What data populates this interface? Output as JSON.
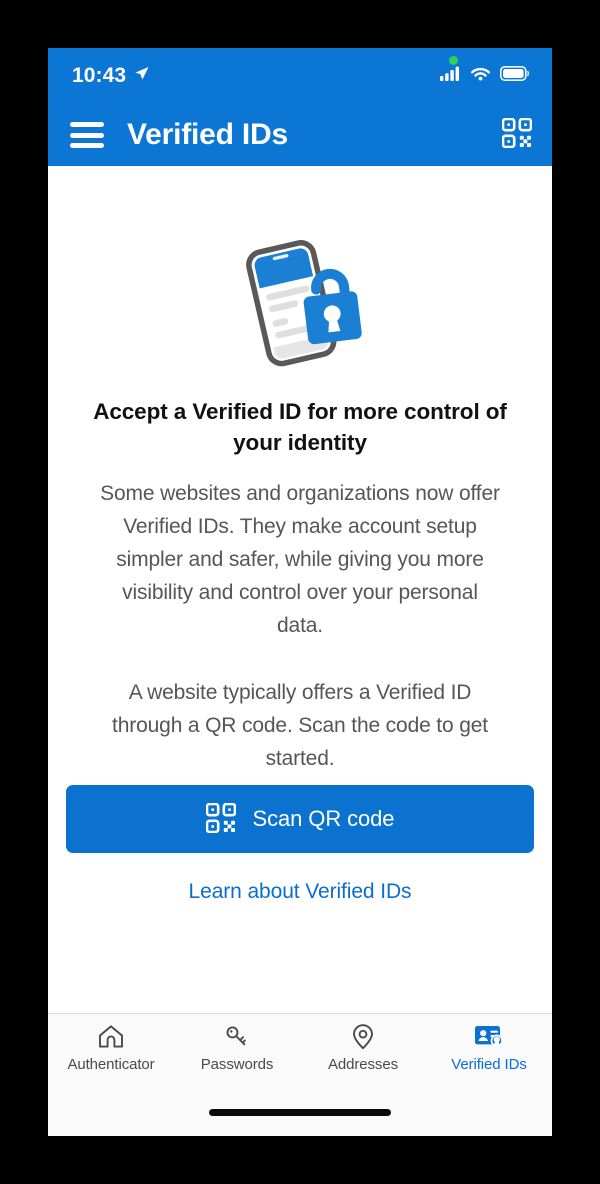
{
  "theme": {
    "brand_blue": "#0b76d4",
    "button_blue": "#0b72cf",
    "link_blue": "#0a6ed1",
    "text_dark": "#111111",
    "text_muted": "#565656",
    "tab_inactive": "#4a4a4a",
    "privacy_dot": "#30d158",
    "screen_bg": "#ffffff",
    "tabbar_bg": "#fafafa"
  },
  "status_bar": {
    "time": "10:43",
    "location_icon": "location-arrow-icon",
    "privacy_indicator": "green-recording-dot",
    "cellular_icon": "cellular-signal-icon",
    "wifi_icon": "wifi-icon",
    "battery_icon": "battery-full-icon"
  },
  "nav_bar": {
    "menu_icon": "hamburger-menu-icon",
    "title": "Verified IDs",
    "action_icon": "qr-code-icon"
  },
  "main": {
    "illustration": "phone-with-lock-illustration",
    "headline": "Accept a Verified ID for more control of your identity",
    "paragraphs": [
      "Some websites and organizations now offer Verified IDs. They make account setup simpler and safer, while giving you more visibility and control over your personal data.",
      "A website typically offers a Verified ID through a QR code. Scan the code to get started."
    ],
    "primary_button": {
      "label": "Scan QR code",
      "icon": "qr-code-icon"
    },
    "link": {
      "label": "Learn about Verified IDs"
    }
  },
  "tab_bar": {
    "tabs": [
      {
        "label": "Authenticator",
        "icon": "home-icon",
        "active": false
      },
      {
        "label": "Passwords",
        "icon": "key-icon",
        "active": false
      },
      {
        "label": "Addresses",
        "icon": "location-pin-icon",
        "active": false
      },
      {
        "label": "Verified IDs",
        "icon": "id-card-badge-icon",
        "active": true
      }
    ]
  },
  "home_indicator": {
    "label": "home-indicator-bar"
  }
}
